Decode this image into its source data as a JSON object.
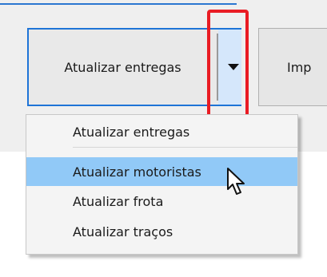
{
  "toolbar": {
    "primary_button_label": "Atualizar entregas",
    "next_button_label": "Imp"
  },
  "dropdown": {
    "items": [
      {
        "label": "Atualizar entregas"
      },
      {
        "label": "Atualizar motoristas"
      },
      {
        "label": "Atualizar frota"
      },
      {
        "label": "Atualizar traços"
      }
    ],
    "highlighted_item": "Atualizar motoristas"
  },
  "colors": {
    "button_border": "#1e74d7",
    "arrow_background": "#d5e7fb",
    "highlight": "#91c9f7",
    "annotation": "#e91c24",
    "link": "#2b77d1"
  }
}
